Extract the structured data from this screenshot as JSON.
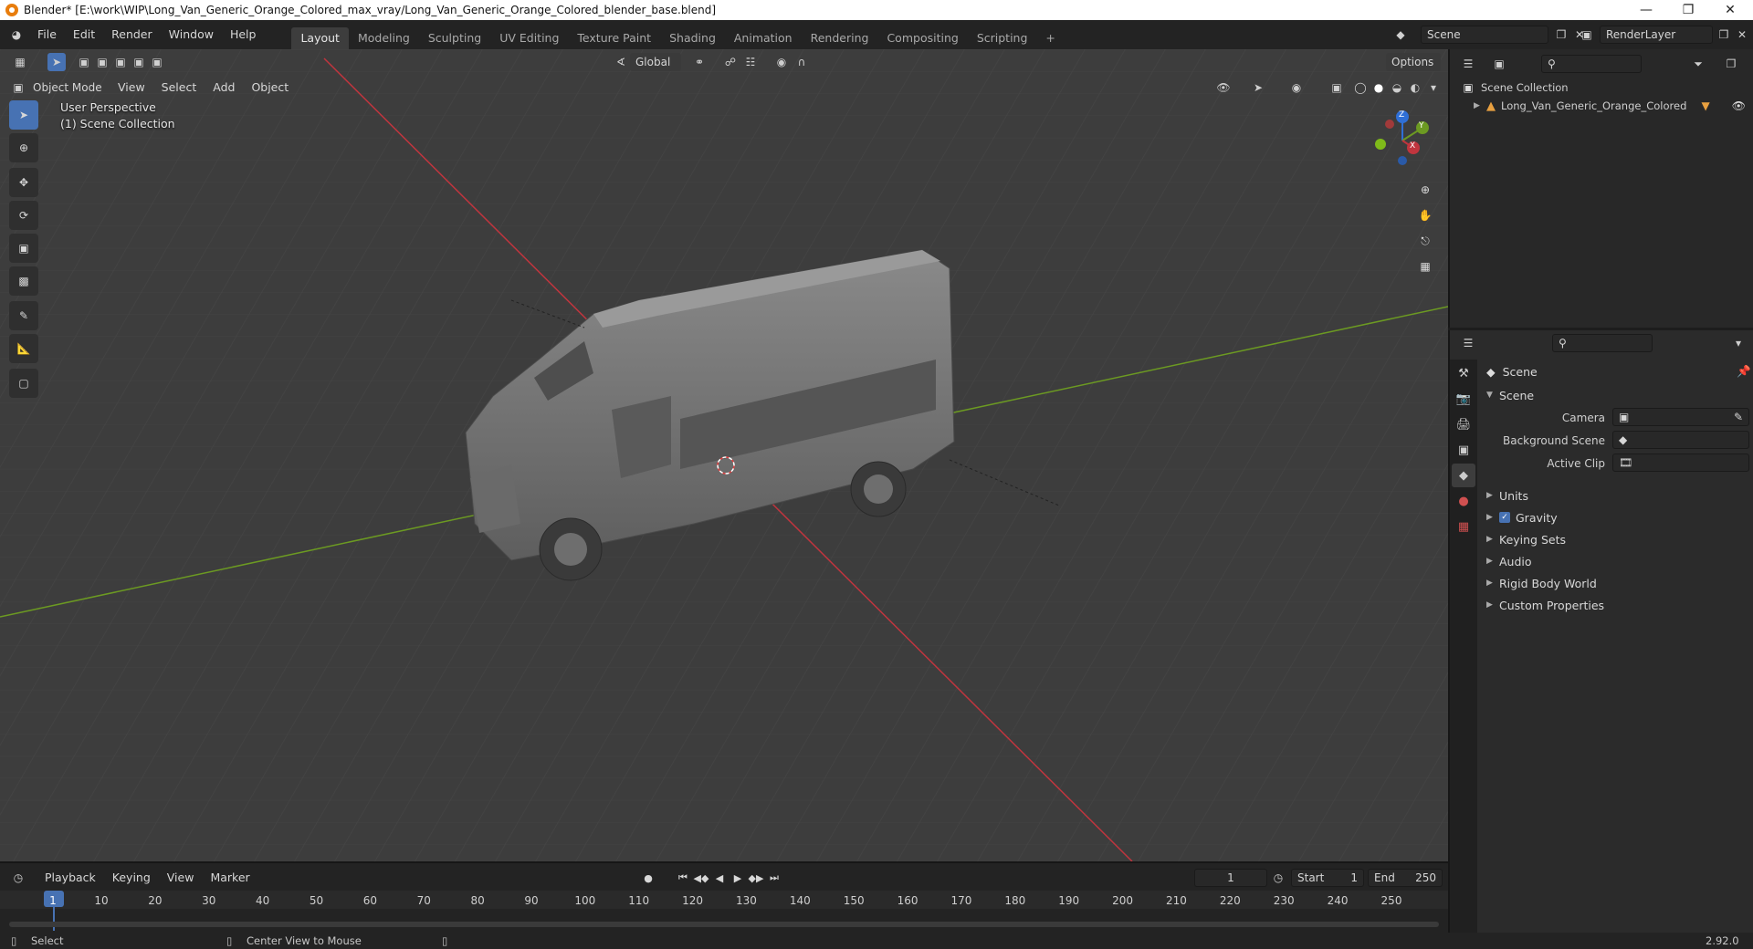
{
  "window": {
    "title": "Blender* [E:\\work\\WIP\\Long_Van_Generic_Orange_Colored_max_vray/Long_Van_Generic_Orange_Colored_blender_base.blend]"
  },
  "menu": [
    "File",
    "Edit",
    "Render",
    "Window",
    "Help"
  ],
  "workspaces": [
    "Layout",
    "Modeling",
    "Sculpting",
    "UV Editing",
    "Texture Paint",
    "Shading",
    "Animation",
    "Rendering",
    "Compositing",
    "Scripting"
  ],
  "active_workspace": "Layout",
  "scene_field": "Scene",
  "renderlayer_field": "RenderLayer",
  "viewport": {
    "mode": "Object Mode",
    "menus": [
      "View",
      "Select",
      "Add",
      "Object"
    ],
    "transform_orientation": "Global",
    "options_label": "Options",
    "perspective_label": "User Perspective",
    "collection_label": "(1) Scene Collection",
    "gizmo_axes": {
      "x": "X",
      "y": "Y",
      "z": "Z"
    },
    "colors": {
      "x_axis": "#c0353e",
      "y_axis": "#6c9a22",
      "grid": "#4a4a4a",
      "background": "#3d3d3d"
    }
  },
  "outliner": {
    "root": "Scene Collection",
    "items": [
      {
        "name": "Long_Van_Generic_Orange_Colored"
      }
    ]
  },
  "properties": {
    "header": "Scene",
    "section": "Scene",
    "fields": [
      {
        "label": "Camera",
        "value": ""
      },
      {
        "label": "Background Scene",
        "value": ""
      },
      {
        "label": "Active Clip",
        "value": ""
      }
    ],
    "panels": [
      {
        "label": "Units",
        "checkbox": false
      },
      {
        "label": "Gravity",
        "checkbox": true
      },
      {
        "label": "Keying Sets",
        "checkbox": false
      },
      {
        "label": "Audio",
        "checkbox": false
      },
      {
        "label": "Rigid Body World",
        "checkbox": false
      },
      {
        "label": "Custom Properties",
        "checkbox": false
      }
    ]
  },
  "timeline": {
    "menus": [
      "Playback",
      "Keying",
      "View",
      "Marker"
    ],
    "current_frame": "1",
    "start_label": "Start",
    "start": "1",
    "end_label": "End",
    "end": "250",
    "ticks": [
      "1",
      "10",
      "20",
      "30",
      "40",
      "50",
      "60",
      "70",
      "80",
      "90",
      "100",
      "110",
      "120",
      "130",
      "140",
      "150",
      "160",
      "170",
      "180",
      "190",
      "200",
      "210",
      "220",
      "230",
      "240",
      "250"
    ]
  },
  "statusbar": {
    "left": "Select",
    "middle": "Center View to Mouse",
    "version": "2.92.0"
  }
}
